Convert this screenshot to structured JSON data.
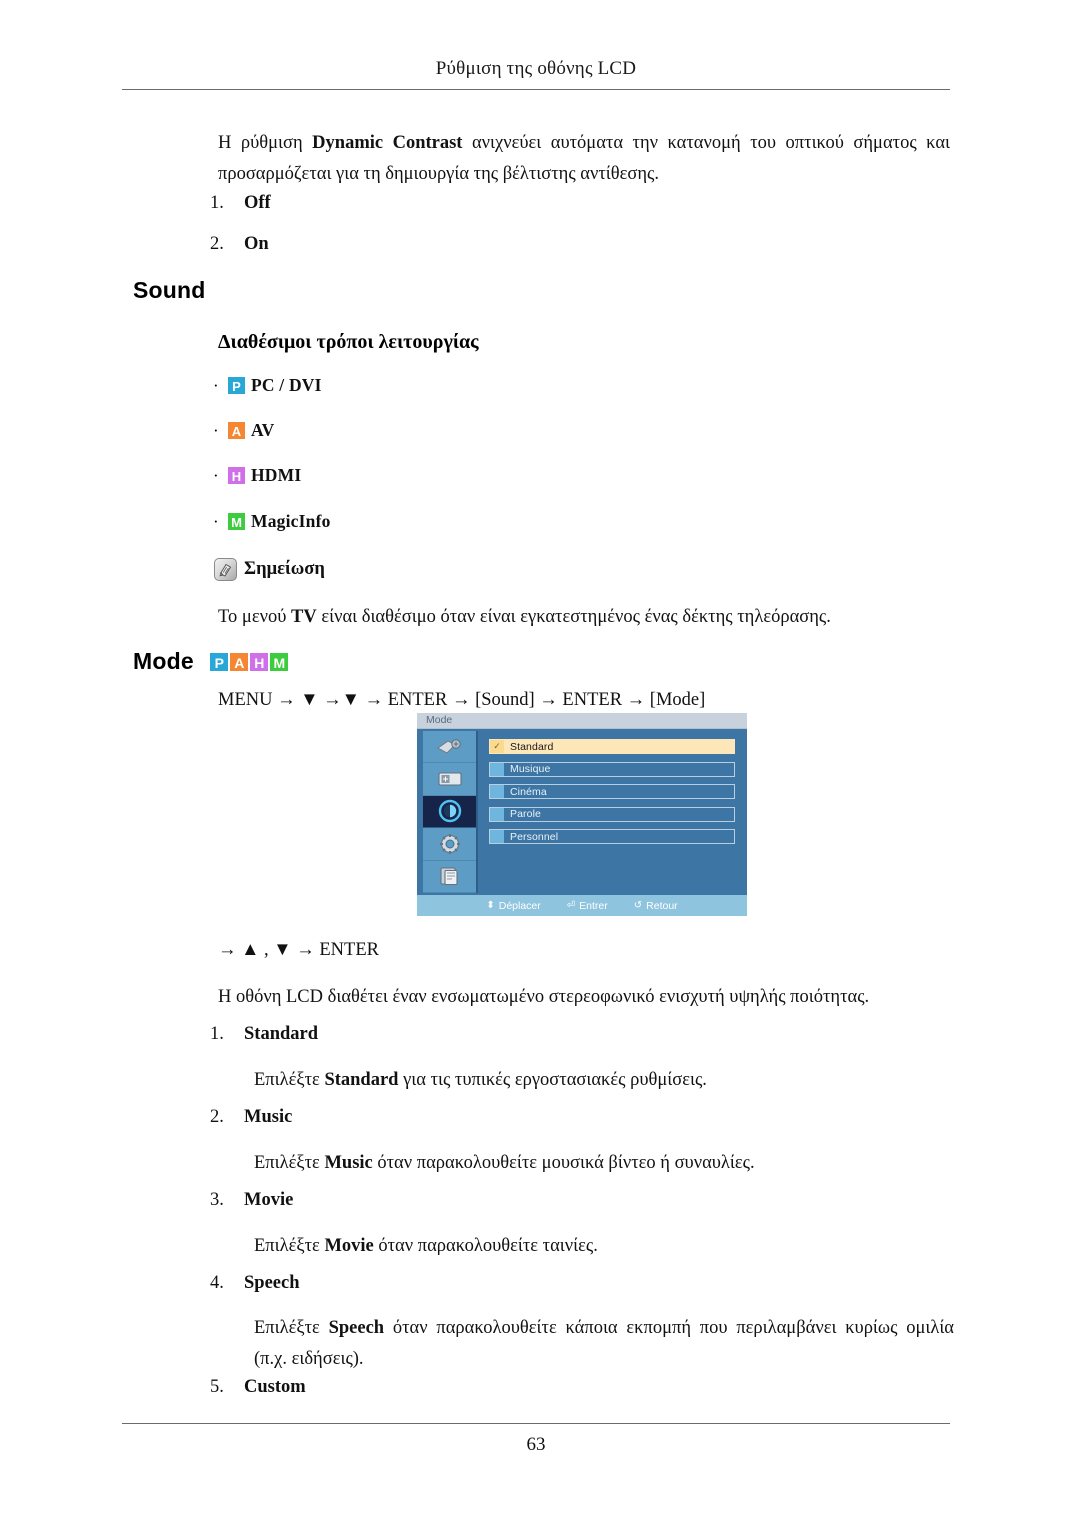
{
  "header": {
    "title": "Ρύθμιση της οθόνης LCD"
  },
  "footer": {
    "page_number": "63"
  },
  "intro": {
    "paragraph_prefix": "Η ρύθμιση ",
    "paragraph_bold": "Dynamic Contrast",
    "paragraph_suffix": " ανιχνεύει αυτόματα την κατανομή του οπτικού σήματος και προσαρμόζεται για τη δημιουργία της βέλτιστης αντίθεσης.",
    "options": [
      {
        "num": "1.",
        "label": "Off"
      },
      {
        "num": "2.",
        "label": "On"
      }
    ]
  },
  "sound_section": {
    "heading": "Sound",
    "subheading": "Διαθέσιμοι τρόποι λειτουργίας",
    "modes": [
      {
        "badge": "P",
        "color": "#29a8d8",
        "label": "PC / DVI"
      },
      {
        "badge": "A",
        "color": "#f58634",
        "label": "AV"
      },
      {
        "badge": "H",
        "color": "#d070e8",
        "label": "HDMI"
      },
      {
        "badge": "M",
        "color": "#3dcc3d",
        "label": "MagicInfo"
      }
    ],
    "note": {
      "icon": "note-icon",
      "label": "Σημείωση",
      "text_prefix": "Το μενού ",
      "text_bold": "TV",
      "text_suffix": " είναι διαθέσιμο όταν είναι εγκατεστημένος ένας δέκτης τηλεόρασης."
    }
  },
  "mode_section": {
    "heading": "Mode",
    "badges": [
      {
        "badge": "P",
        "color": "#29a8d8"
      },
      {
        "badge": "A",
        "color": "#f58634"
      },
      {
        "badge": "H",
        "color": "#d070e8"
      },
      {
        "badge": "M",
        "color": "#3dcc3d"
      }
    ],
    "menu_path": "MENU → ▼ →▼ → ENTER → [Sound] → ENTER → [Mode]",
    "nav_line": "→ ▲ , ▼ → ENTER",
    "description": "Η οθόνη LCD διαθέτει έναν ενσωματωμένο στερεοφωνικό ενισχυτή υψηλής ποιότητας.",
    "items": [
      {
        "num": "1.",
        "label": "Standard",
        "desc_prefix": "Επιλέξτε ",
        "desc_bold": "Standard",
        "desc_suffix": " για τις τυπικές εργοστασιακές ρυθμίσεις."
      },
      {
        "num": "2.",
        "label": "Music",
        "desc_prefix": "Επιλέξτε ",
        "desc_bold": "Music",
        "desc_suffix": " όταν παρακολουθείτε μουσικά βίντεο ή συναυλίες."
      },
      {
        "num": "3.",
        "label": "Movie",
        "desc_prefix": "Επιλέξτε ",
        "desc_bold": "Movie",
        "desc_suffix": " όταν παρακολουθείτε ταινίες."
      },
      {
        "num": "4.",
        "label": "Speech",
        "desc_prefix": "Επιλέξτε ",
        "desc_bold": "Speech",
        "desc_suffix": " όταν παρακολουθείτε κάποια εκπομπή που περιλαμβάνει κυρίως ομιλία (π.χ. ειδήσεις)."
      },
      {
        "num": "5.",
        "label": "Custom",
        "desc_prefix": "",
        "desc_bold": "",
        "desc_suffix": ""
      }
    ]
  },
  "osd": {
    "title": "Mode",
    "sidebar_icons": [
      "picture-icon",
      "image-size-icon",
      "sound-icon",
      "setup-gear-icon",
      "multi-control-icon"
    ],
    "active_sidebar_index": 2,
    "list": [
      {
        "label": "Standard",
        "selected": true,
        "check": "✓"
      },
      {
        "label": "Musique",
        "selected": false,
        "check": ""
      },
      {
        "label": "Cinéma",
        "selected": false,
        "check": ""
      },
      {
        "label": "Parole",
        "selected": false,
        "check": ""
      },
      {
        "label": "Personnel",
        "selected": false,
        "check": ""
      }
    ],
    "footer": [
      {
        "glyph": "⬍",
        "label": "Déplacer"
      },
      {
        "glyph": "⏎",
        "label": "Entrer"
      },
      {
        "glyph": "↺",
        "label": "Retour"
      }
    ]
  }
}
